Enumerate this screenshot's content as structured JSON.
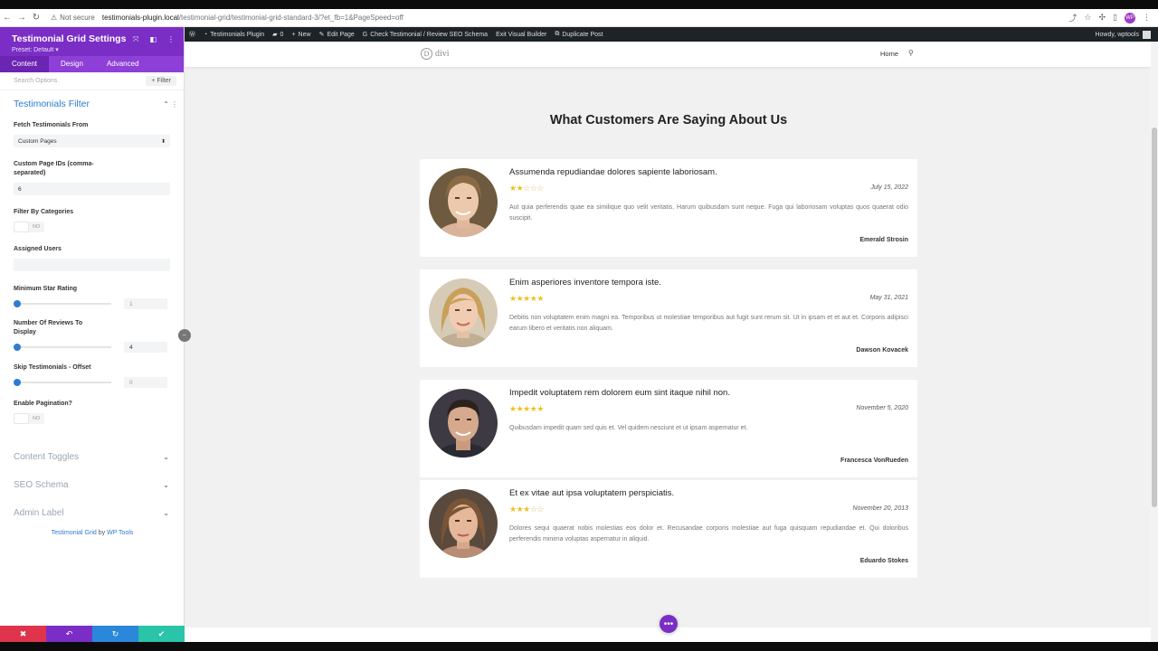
{
  "browser": {
    "not_secure": "Not secure",
    "url_host": "testimonials-plugin.local",
    "url_path": "/testimonial-grid/testimonial-grid-standard-3/?et_fb=1&PageSpeed=off",
    "profile_initials": "WP"
  },
  "panel": {
    "title": "Testimonial Grid Settings",
    "preset": "Preset: Default ▾",
    "tabs": [
      "Content",
      "Design",
      "Advanced"
    ],
    "search_placeholder": "Search Options",
    "filter_label": "+ Filter",
    "section_title": "Testimonials Filter",
    "fields": {
      "fetch_label": "Fetch Testimonials From",
      "fetch_value": "Custom Pages",
      "custom_ids_label_1": "Custom Page IDs (comma-",
      "custom_ids_label_2": "separated)",
      "custom_ids_value": "6",
      "filter_categories_label": "Filter By Categories",
      "filter_categories_value": "NO",
      "assigned_users_label": "Assigned Users",
      "assigned_users_value": "",
      "min_star_label": "Minimum Star Rating",
      "min_star_value": "1",
      "num_reviews_label_1": "Number Of Reviews To",
      "num_reviews_label_2": "Display",
      "num_reviews_value": "4",
      "skip_label": "Skip Testimonials - Offset",
      "skip_value": "0",
      "pagination_label": "Enable Pagination?",
      "pagination_value": "NO"
    },
    "collapsed_sections": [
      "Content Toggles",
      "SEO Schema",
      "Admin Label"
    ],
    "credit": {
      "link1": "Testimonial Grid",
      "by": "by",
      "link2": "WP Tools"
    }
  },
  "wpbar": {
    "site_name": "Testimonials Plugin",
    "comments": "0",
    "new": "New",
    "edit_page": "Edit Page",
    "check": "Check Testimonial / Review SEO Schema",
    "exit": "Exit Visual Builder",
    "duplicate": "Duplicate Post",
    "howdy": "Howdy, wptools"
  },
  "site": {
    "logo": "divi",
    "nav_home": "Home",
    "heading": "What Customers Are Saying About Us"
  },
  "testimonials": [
    {
      "title": "Assumenda repudiandae dolores sapiente laboriosam.",
      "rating": 2,
      "date": "July 15, 2022",
      "text": "Aut quia perferendis quae ea similique quo velit veritatis. Harum quibusdam sunt neque. Fuga qui laboriosam voluptas quos quaerat odio suscipit.",
      "author": "Emerald Strosin"
    },
    {
      "title": "Enim asperiores inventore tempora iste.",
      "rating": 5,
      "date": "May 31, 2021",
      "text": "Debitis non voluptatem enim magni ea. Temporibus ut molestiae temporibus aut fugit sunt rerum sit. Ut in ipsam et et aut et. Corporis adipisci earum libero et veritatis non aliquam.",
      "author": "Dawson Kovacek"
    },
    {
      "title": "Impedit voluptatem rem dolorem eum sint itaque nihil non.",
      "rating": 5,
      "date": "November 5, 2020",
      "text": "Quibusdam impedit quam sed quis et. Vel quidem nesciunt et ut ipsam aspernatur et.",
      "author": "Francesca VonRueden"
    },
    {
      "title": "Et ex vitae aut ipsa voluptatem perspiciatis.",
      "rating": 3,
      "date": "November 20, 2013",
      "text": "Dolores sequi quaerat nobis molestias eos dolor et. Recusandae corporis molestiae aut fuga quisquam repudiandae et. Qui doloribus perferendis minima voluptas aspernatur in aliquid.",
      "author": "Eduardo Stokes"
    }
  ],
  "colors": {
    "accent": "#7b2ec6",
    "link": "#2e7bd0",
    "star": "#f0c020",
    "cancel": "#e0344c",
    "undo": "#7b2ec6",
    "redo": "#2b87da",
    "save": "#29c4a9"
  }
}
